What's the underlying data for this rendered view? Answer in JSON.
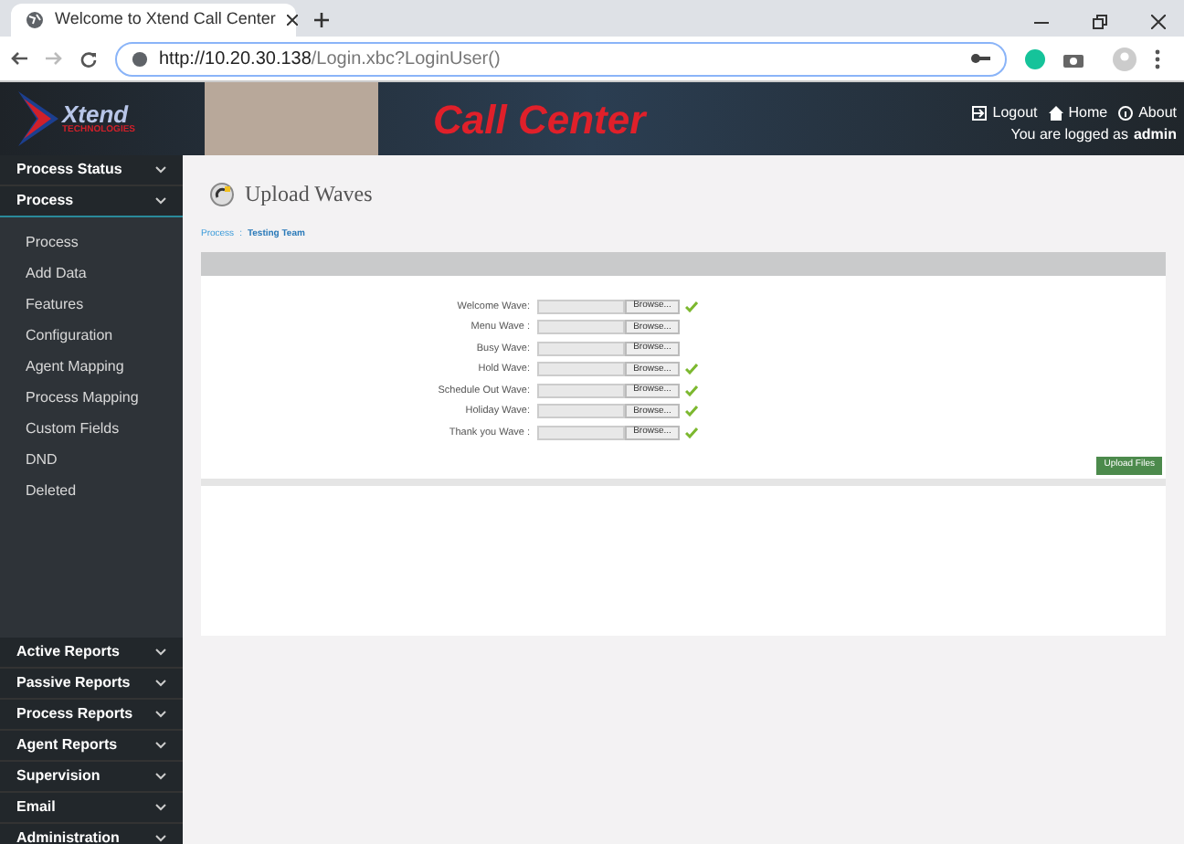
{
  "browser": {
    "tab_title": "Welcome to Xtend Call Center",
    "url_host": "http://10.20.30.138",
    "url_path": "/Login.xbc?LoginUser()"
  },
  "header": {
    "logo_text": "Xtend",
    "logo_subtext": "TECHNOLOGIES",
    "banner_title": "Call Center",
    "links": [
      {
        "label": "Logout"
      },
      {
        "label": "Home"
      },
      {
        "label": "About"
      }
    ],
    "login_text": "You are logged as",
    "user": "admin"
  },
  "sidebar": {
    "top_items": [
      {
        "label": "Process Status",
        "expanded": false
      },
      {
        "label": "Process",
        "expanded": true,
        "children": [
          {
            "label": "Process"
          },
          {
            "label": "Add Data"
          },
          {
            "label": "Features"
          },
          {
            "label": "Configuration"
          },
          {
            "label": "Agent Mapping"
          },
          {
            "label": "Process Mapping"
          },
          {
            "label": "Custom Fields"
          },
          {
            "label": "DND"
          },
          {
            "label": "Deleted"
          }
        ]
      }
    ],
    "bottom_items": [
      {
        "label": "Active Reports"
      },
      {
        "label": "Passive Reports"
      },
      {
        "label": "Process Reports"
      },
      {
        "label": "Agent Reports"
      },
      {
        "label": "Supervision"
      },
      {
        "label": "Email"
      },
      {
        "label": "Administration"
      }
    ]
  },
  "page": {
    "title": "Upload Waves",
    "breadcrumb": [
      "Process",
      ":",
      "Testing Team"
    ],
    "fields": [
      {
        "label": "Welcome Wave:",
        "button": "Browse...",
        "uploaded": true
      },
      {
        "label": "Menu Wave :",
        "button": "Browse...",
        "uploaded": false
      },
      {
        "label": "Busy Wave:",
        "button": "Browse...",
        "uploaded": false
      },
      {
        "label": "Hold Wave:",
        "button": "Browse...",
        "uploaded": true
      },
      {
        "label": "Schedule Out Wave:",
        "button": "Browse...",
        "uploaded": true
      },
      {
        "label": "Holiday Wave:",
        "button": "Browse...",
        "uploaded": true
      },
      {
        "label": "Thank you Wave :",
        "button": "Browse...",
        "uploaded": true
      }
    ],
    "submit": "Upload Files"
  }
}
